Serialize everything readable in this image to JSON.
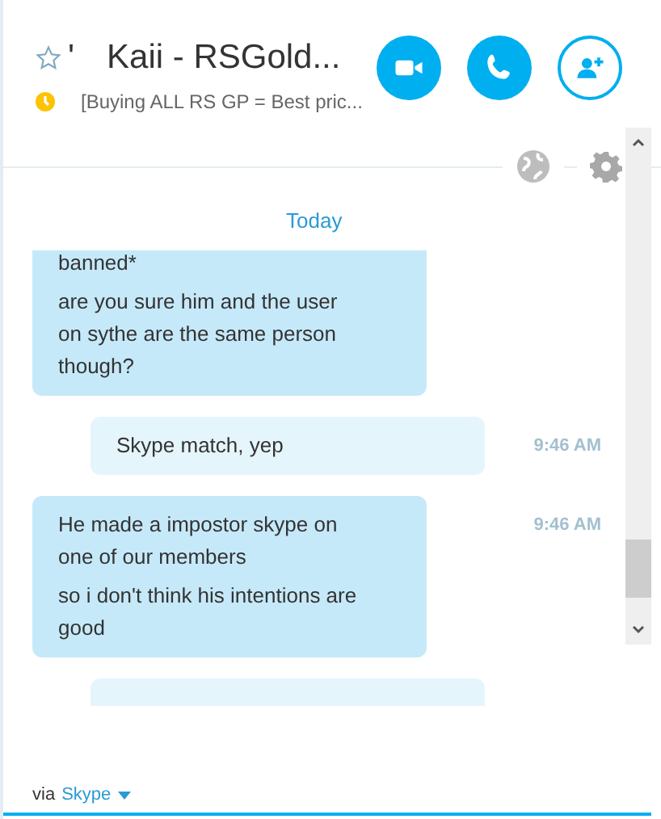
{
  "header": {
    "favorite": false,
    "title_prefix": "'",
    "title": "Kaii - RSGold...",
    "away": true,
    "mood": "[Buying ALL RS GP = Best pric..."
  },
  "call_buttons": [
    {
      "kind": "video"
    },
    {
      "kind": "call"
    },
    {
      "kind": "add-contact"
    }
  ],
  "date_divider": "Today",
  "messages": [
    {
      "outgoing": false,
      "lines": [
        "banned*",
        "are you sure him and the user on sythe are the same person though?"
      ]
    },
    {
      "outgoing": true,
      "lines": [
        "Skype match, yep"
      ],
      "time": "9:46 AM"
    },
    {
      "outgoing": false,
      "lines": [
        "He made a impostor skype on one of our members",
        "so i don't think his intentions are good"
      ],
      "time": "9:46 AM"
    },
    {
      "outgoing": true
    }
  ],
  "footer": {
    "via": "via",
    "service": "Skype"
  }
}
